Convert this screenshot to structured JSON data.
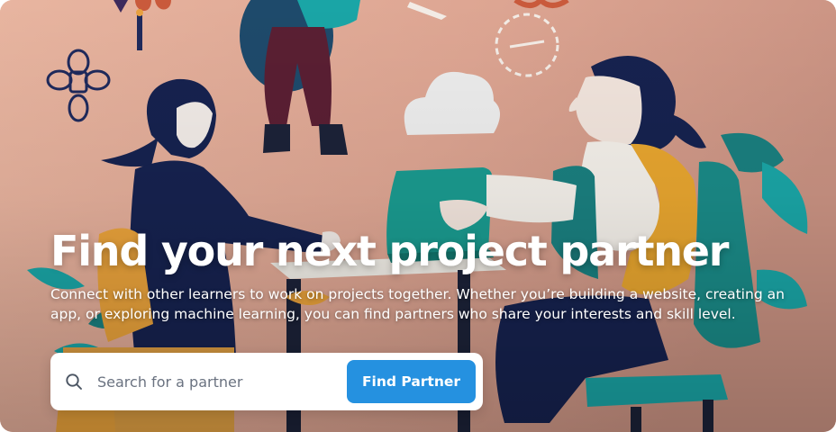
{
  "hero": {
    "title": "Find your next project partner",
    "description": "Connect with other learners to work on projects together. Whether you’re building a website, creating an app, or exploring machine learning, you can find partners who share your interests and skill level.",
    "illustration": "two people collaborating at a table with plants and clouds"
  },
  "search": {
    "placeholder": "Search for a partner",
    "value": "",
    "icon": "search-icon",
    "button_label": "Find Partner"
  },
  "colors": {
    "background": "#e3ad98",
    "button": "#2591e0",
    "title": "#ffffff"
  }
}
